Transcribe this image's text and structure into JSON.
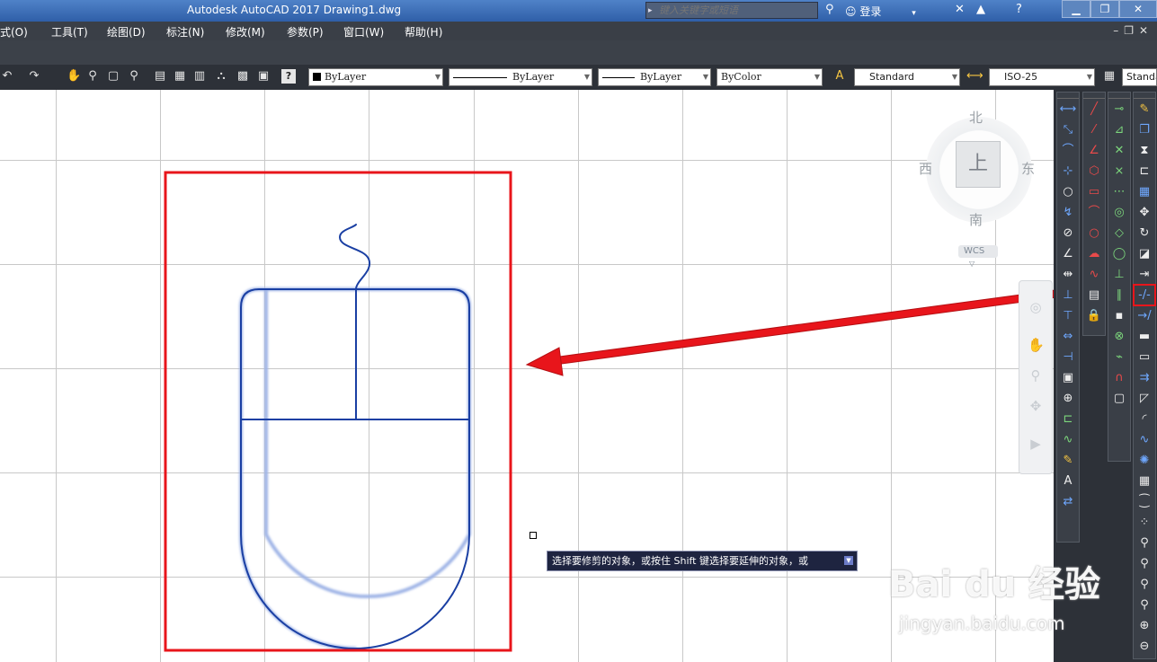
{
  "titlebar": {
    "title": "Autodesk AutoCAD 2017    Drawing1.dwg",
    "search_placeholder": "键入关键字或短语",
    "login_label": "登录"
  },
  "menu": {
    "items": [
      "式(O)",
      "工具(T)",
      "绘图(D)",
      "标注(N)",
      "修改(M)",
      "参数(P)",
      "窗口(W)",
      "帮助(H)"
    ]
  },
  "toolbar": {
    "color_combo": "ByLayer",
    "linetype_combo": "ByLayer",
    "lineweight_combo": "ByLayer",
    "plotstyle_combo": "ByColor",
    "text_style_combo": "Standard",
    "dim_style_combo": "ISO-25",
    "table_style_combo": "Standa"
  },
  "viewcube": {
    "north": "北",
    "south": "南",
    "east": "东",
    "west": "西",
    "face": "上",
    "coordinate_system": "WCS"
  },
  "command": {
    "tooltip": "选择要修剪的对象，或按住 Shift 键选择要延伸的对象，或"
  },
  "watermark": {
    "brand": "Bai du 经验",
    "url": "jingyan.baidu.com"
  },
  "colors": {
    "drawing_line": "#1a3fa3",
    "highlight_box": "#e8151b",
    "arrow": "#e8151b",
    "grid": "#c8c8c8",
    "panel_bg": "#2d3138"
  }
}
